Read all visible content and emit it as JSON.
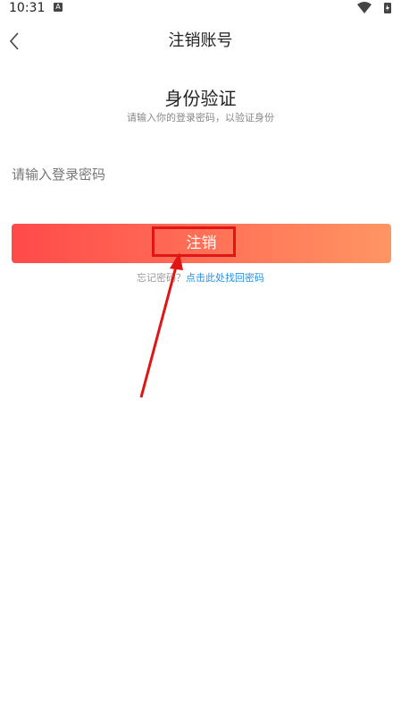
{
  "status_bar": {
    "time": "10:31",
    "notification_icon": "a-icon"
  },
  "header": {
    "back_icon": "chevron-left-icon",
    "title": "注销账号"
  },
  "verify": {
    "title": "身份验证",
    "subtitle": "请输入你的登录密码，以验证身份",
    "password_placeholder": "请输入登录密码"
  },
  "actions": {
    "cancel_label": "注销",
    "forgot_question": "忘记密码？",
    "forgot_link": "点击此处找回密码"
  },
  "annotation": {
    "color": "#e01515"
  }
}
